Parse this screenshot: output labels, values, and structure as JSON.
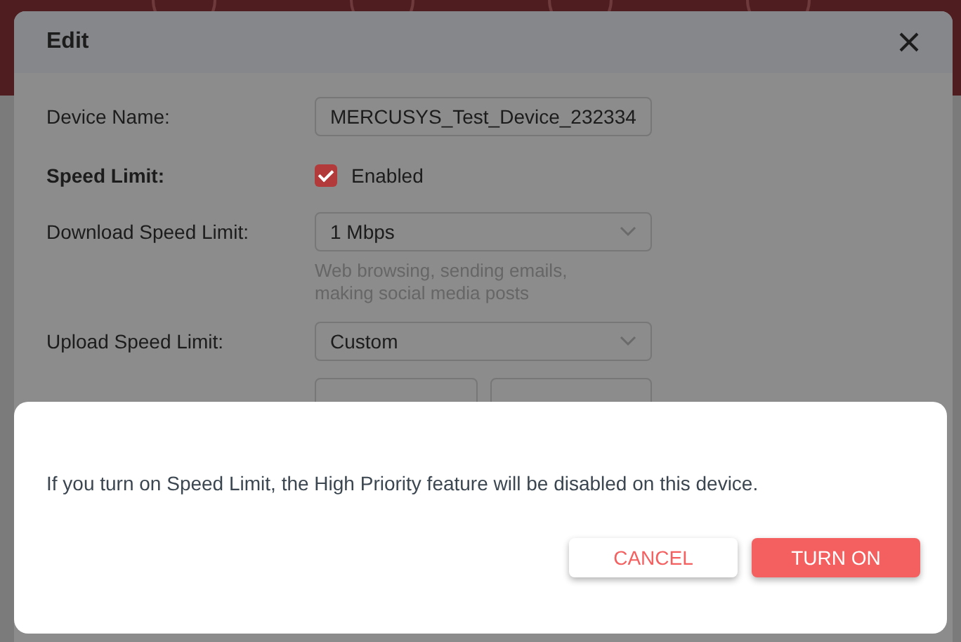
{
  "edit_dialog": {
    "title": "Edit",
    "fields": [
      {
        "kind": "text",
        "label": "Device Name:",
        "value": "MERCUSYS_Test_Device_232334"
      },
      {
        "kind": "checkbox",
        "label": "Speed Limit:",
        "option": "Enabled",
        "checked": true
      },
      {
        "kind": "select",
        "label": "Download Speed Limit:",
        "value": "1 Mbps",
        "hint": "Web browsing, sending emails, making social media posts"
      },
      {
        "kind": "select",
        "label": "Upload Speed Limit:",
        "value": "Custom"
      },
      {
        "kind": "pair"
      }
    ]
  },
  "confirm_dialog": {
    "message": "If you turn on Speed Limit, the High Priority feature will be disabled on this device.",
    "buttons": [
      {
        "label": "CANCEL",
        "kind": "secondary"
      },
      {
        "label": "TURN ON",
        "kind": "primary"
      }
    ]
  }
}
